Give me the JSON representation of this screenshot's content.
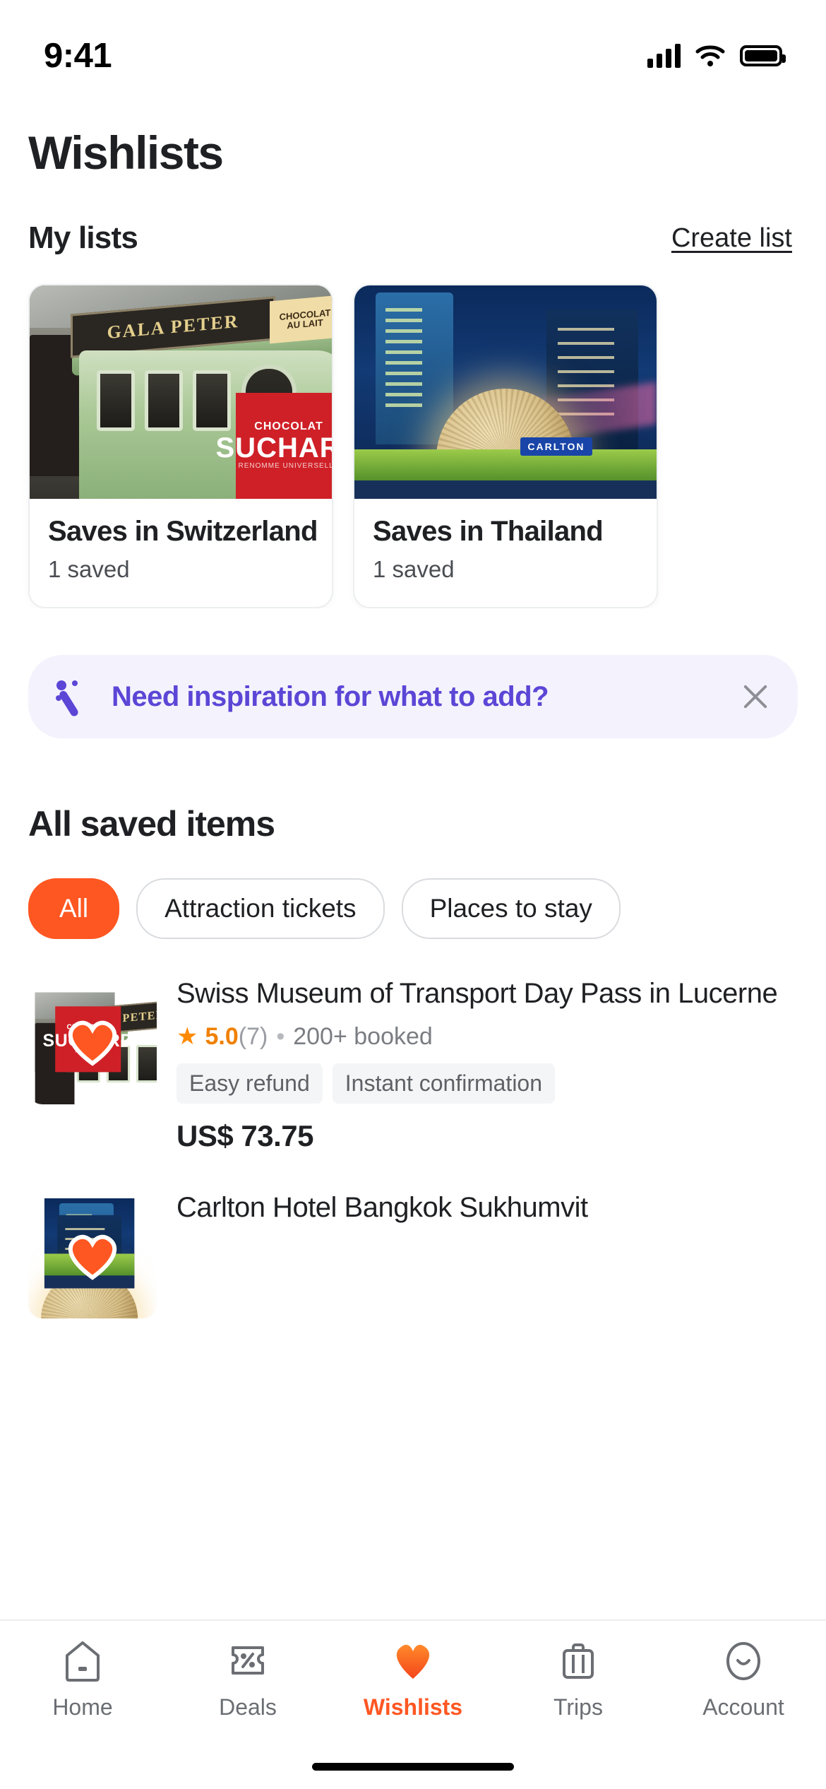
{
  "status_bar": {
    "time": "9:41",
    "signal_icon": "cellular-signal-icon",
    "wifi_icon": "wifi-icon",
    "battery_icon": "battery-icon"
  },
  "header": {
    "title": "Wishlists"
  },
  "my_lists": {
    "section_title": "My lists",
    "create_link": "Create list",
    "cards": [
      {
        "name": "Saves in Switzerland",
        "count": "1 saved",
        "image_alt": "vintage-swiss-tram-gala-peter-chocolate",
        "ad_line1": "CHOCOLAT",
        "ad_line2": "AU LAIT",
        "board_text": "GALA PETER",
        "red_top": "CHOCOLAT",
        "red_main": "SUCHARD",
        "red_sub": "RENOMME UNIVERSELLE"
      },
      {
        "name": "Saves in Thailand",
        "count": "1 saved",
        "image_alt": "bangkok-night-carlton-sphere-sculpture",
        "sphere_badge": "CARLTON"
      }
    ]
  },
  "inspiration_banner": {
    "icon": "magic-wand-sparkle-icon",
    "text": "Need inspiration for what to add?",
    "close_icon": "close-icon",
    "accent_color": "#5b46d6",
    "background_color": "#f4f2fd"
  },
  "all_saved": {
    "section_title": "All saved items",
    "filters": [
      {
        "label": "All",
        "active": true
      },
      {
        "label": "Attraction tickets",
        "active": false
      },
      {
        "label": "Places to stay",
        "active": false
      }
    ],
    "items": [
      {
        "title": "Swiss Museum of Transport Day Pass in Lucerne",
        "star": "★",
        "rating": "5.0",
        "review_count": "(7)",
        "separator": "•",
        "booked": "200+ booked",
        "badges": [
          "Easy refund",
          "Instant confirmation"
        ],
        "price": "US$ 73.75",
        "heart_icon": "heart-icon",
        "image_alt": "swiss-tram-thumbnail"
      },
      {
        "title": "Carlton Hotel Bangkok Sukhumvit",
        "heart_icon": "heart-icon",
        "image_alt": "carlton-bangkok-thumbnail"
      }
    ]
  },
  "tab_bar": {
    "active_color": "#ff5722",
    "inactive_color": "#6b6e73",
    "tabs": [
      {
        "label": "Home",
        "icon": "home-icon",
        "active": false
      },
      {
        "label": "Deals",
        "icon": "ticket-percent-icon",
        "active": false
      },
      {
        "label": "Wishlists",
        "icon": "heart-icon",
        "active": true
      },
      {
        "label": "Trips",
        "icon": "suitcase-icon",
        "active": false
      },
      {
        "label": "Account",
        "icon": "smiley-face-icon",
        "active": false
      }
    ]
  }
}
